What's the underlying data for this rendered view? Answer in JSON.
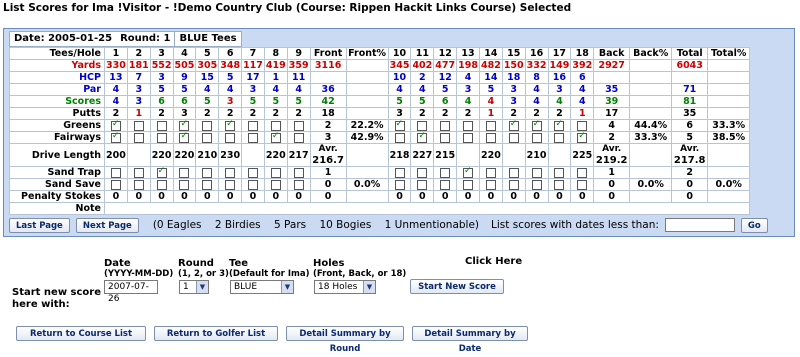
{
  "title": "List Scores for Ima !Visitor - !Demo Country Club (Course: Rippen Hackit Links Course) Selected",
  "round_info": {
    "date": "Date: 2005-01-25",
    "round": "Round: 1",
    "tees": "BLUE Tees"
  },
  "headers": {
    "label": "Tees/Hole",
    "holes_front": [
      "1",
      "2",
      "3",
      "4",
      "5",
      "6",
      "7",
      "8",
      "9"
    ],
    "front": "Front",
    "front_pct": "Front%",
    "holes_back": [
      "10",
      "11",
      "12",
      "13",
      "14",
      "15",
      "16",
      "17",
      "18"
    ],
    "back": "Back",
    "back_pct": "Back%",
    "total": "Total",
    "total_pct": "Total%"
  },
  "rows": {
    "yards": {
      "label": "Yards",
      "front": [
        "330",
        "181",
        "552",
        "505",
        "305",
        "348",
        "117",
        "419",
        "359"
      ],
      "front_total": "3116",
      "back": [
        "345",
        "402",
        "477",
        "198",
        "482",
        "150",
        "332",
        "149",
        "392"
      ],
      "back_total": "2927",
      "total": "6043"
    },
    "hcp": {
      "label": "HCP",
      "front": [
        "13",
        "7",
        "3",
        "9",
        "15",
        "5",
        "17",
        "1",
        "11"
      ],
      "back": [
        "10",
        "2",
        "12",
        "4",
        "14",
        "18",
        "8",
        "16",
        "6"
      ]
    },
    "par": {
      "label": "Par",
      "front": [
        "4",
        "3",
        "5",
        "5",
        "4",
        "4",
        "3",
        "4",
        "4"
      ],
      "front_total": "36",
      "back": [
        "4",
        "4",
        "5",
        "3",
        "5",
        "3",
        "4",
        "3",
        "4"
      ],
      "back_total": "35",
      "total": "71"
    },
    "scores": {
      "label": "Scores",
      "front": [
        "4",
        "3",
        "6",
        "6",
        "5",
        "3",
        "5",
        "5",
        "5"
      ],
      "front_total": "42",
      "front_colors": [
        "blue",
        "blue",
        "green",
        "green",
        "green",
        "red",
        "green",
        "green",
        "green"
      ],
      "back": [
        "5",
        "5",
        "6",
        "4",
        "4",
        "3",
        "4",
        "4",
        "4"
      ],
      "back_total": "39",
      "back_colors": [
        "green",
        "green",
        "green",
        "green",
        "red",
        "blue",
        "blue",
        "green",
        "blue"
      ],
      "total": "81"
    },
    "putts": {
      "label": "Putts",
      "front": [
        "2",
        "1",
        "2",
        "3",
        "2",
        "2",
        "2",
        "2",
        "2"
      ],
      "front_total": "18",
      "front_colors": [
        "",
        "red",
        "",
        "",
        "",
        "",
        "",
        "",
        ""
      ],
      "back": [
        "3",
        "2",
        "2",
        "2",
        "1",
        "2",
        "2",
        "2",
        "1"
      ],
      "back_total": "17",
      "back_colors": [
        "",
        "",
        "",
        "",
        "red",
        "",
        "",
        "",
        "red"
      ],
      "total": "35"
    },
    "greens": {
      "label": "Greens",
      "front": [
        1,
        0,
        0,
        1,
        0,
        1,
        0,
        0,
        0
      ],
      "front_total": "2",
      "front_pct": "22.2%",
      "back": [
        1,
        0,
        0,
        0,
        0,
        1,
        1,
        1,
        0
      ],
      "back_total": "4",
      "back_pct": "44.4%",
      "total": "6",
      "total_pct": "33.3%"
    },
    "fairways": {
      "label": "Fairways",
      "front": [
        1,
        0,
        0,
        1,
        0,
        0,
        0,
        1,
        0
      ],
      "front_total": "3",
      "front_pct": "42.9%",
      "back": [
        0,
        1,
        0,
        0,
        0,
        0,
        0,
        0,
        1
      ],
      "back_total": "2",
      "back_pct": "33.3%",
      "total": "5",
      "total_pct": "38.5%"
    },
    "drive": {
      "label": "Drive Length",
      "front": [
        "200",
        "",
        "220",
        "220",
        "210",
        "230",
        "",
        "220",
        "217"
      ],
      "front_avg_label": "Avr.",
      "front_avg": "216.7",
      "back": [
        "218",
        "227",
        "215",
        "",
        "220",
        "",
        "210",
        "",
        "225"
      ],
      "back_avg_label": "Avr.",
      "back_avg": "219.2",
      "total_avg_label": "Avr.",
      "total_avg": "217.8"
    },
    "sandtrap": {
      "label": "Sand Trap",
      "front": [
        0,
        0,
        1,
        0,
        0,
        0,
        0,
        0,
        0
      ],
      "front_total": "1",
      "back": [
        0,
        0,
        0,
        1,
        0,
        0,
        0,
        0,
        0
      ],
      "back_total": "1",
      "total": "2"
    },
    "sandsave": {
      "label": "Sand Save",
      "front": [
        0,
        0,
        0,
        0,
        0,
        0,
        0,
        0,
        0
      ],
      "front_total": "0",
      "front_pct": "0.0%",
      "back": [
        0,
        0,
        0,
        0,
        0,
        0,
        0,
        0,
        0
      ],
      "back_total": "0",
      "back_pct": "0.0%",
      "total": "0",
      "total_pct": "0.0%"
    },
    "penalty": {
      "label": "Penalty Stokes",
      "front": [
        "0",
        "0",
        "0",
        "0",
        "0",
        "0",
        "0",
        "0",
        "0"
      ],
      "front_total": "0",
      "back": [
        "0",
        "0",
        "0",
        "0",
        "0",
        "0",
        "0",
        "0",
        "0"
      ],
      "back_total": "0",
      "total": "0"
    },
    "note": {
      "label": "Note"
    }
  },
  "nav": {
    "last_page": "Last Page",
    "next_page": "Next Page",
    "summary": [
      "(0 Eagles",
      "2 Birdies",
      "5 Pars",
      "10 Bogies",
      "1 Unmentionable)"
    ],
    "list_less_than": "List scores with dates less than:",
    "go": "Go"
  },
  "new_score": {
    "heading": "Start new score here with:",
    "date_label": "Date",
    "date_hint": "(YYYY-MM-DD)",
    "date_value": "2007-07-26",
    "round_label": "Round",
    "round_hint": "(1, 2, or 3)",
    "round_value": "1",
    "tee_label": "Tee",
    "tee_hint": "(Default for Ima)",
    "tee_value": "BLUE",
    "holes_label": "Holes",
    "holes_hint": "(Front, Back, or 18)",
    "holes_value": "18 Holes",
    "click_here": "Click Here",
    "start_button": "Start New Score"
  },
  "footer_buttons": [
    "Return to Course List",
    "Return to Golfer List",
    "Detail Summary by Round",
    "Detail Summary by Date"
  ]
}
